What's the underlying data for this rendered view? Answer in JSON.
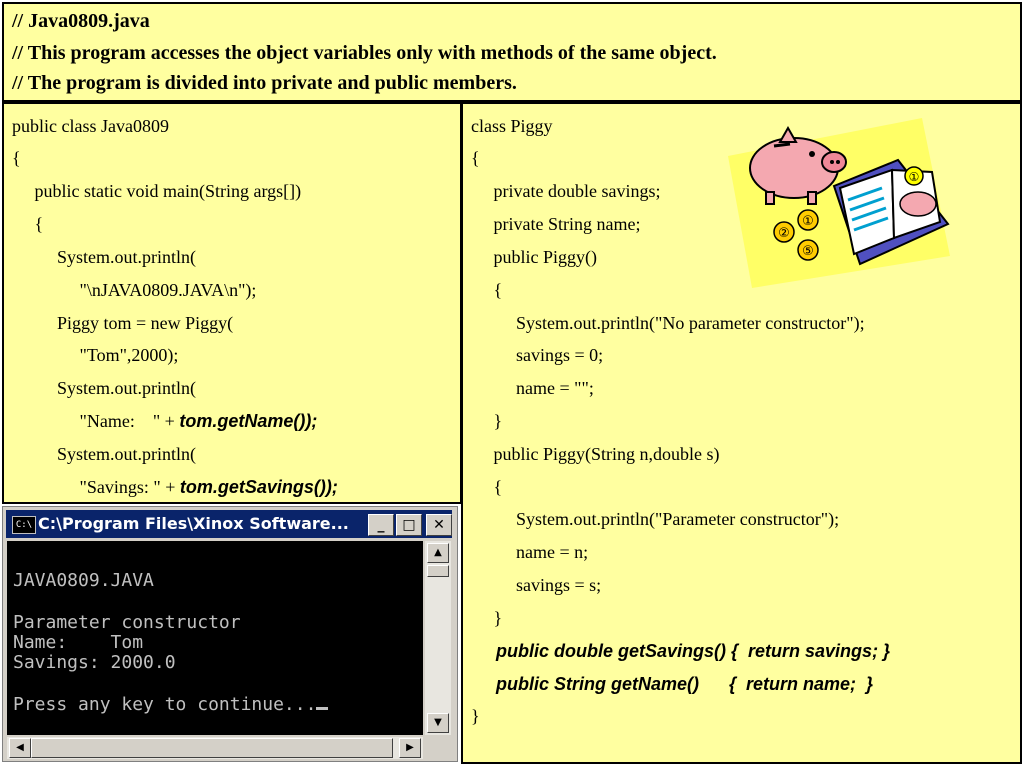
{
  "header": {
    "lines": [
      "// Java0809.java",
      "// This program accesses the object variables only with methods of the same object.",
      "// The program is divided into private and public members."
    ]
  },
  "left_code": [
    {
      "text": "public class Java0809",
      "italic_part": ""
    },
    {
      "text": "{",
      "italic_part": ""
    },
    {
      "text": "     public static void main(String args[])",
      "italic_part": ""
    },
    {
      "text": "     {",
      "italic_part": ""
    },
    {
      "text": "          System.out.println(",
      "italic_part": ""
    },
    {
      "text": "               \"\\nJAVA0809.JAVA\\n\");",
      "italic_part": ""
    },
    {
      "text": "          Piggy tom = new Piggy(",
      "italic_part": ""
    },
    {
      "text": "               \"Tom\",2000);",
      "italic_part": ""
    },
    {
      "text": "          System.out.println(",
      "italic_part": ""
    },
    {
      "text": "               \"Name:    \" + ",
      "italic_part": "tom.getName());"
    },
    {
      "text": "          System.out.println(",
      "italic_part": ""
    },
    {
      "text": "               \"Savings: \" + ",
      "italic_part": "tom.getSavings());"
    }
  ],
  "right_code": [
    {
      "text": "class Piggy",
      "italic": false
    },
    {
      "text": "{",
      "italic": false
    },
    {
      "text": "     private double savings;",
      "italic": false
    },
    {
      "text": "     private String name;",
      "italic": false
    },
    {
      "text": "     public Piggy()",
      "italic": false
    },
    {
      "text": "     {",
      "italic": false
    },
    {
      "text": "          System.out.println(\"No parameter constructor\");",
      "italic": false
    },
    {
      "text": "          savings = 0;",
      "italic": false
    },
    {
      "text": "          name = \"\";",
      "italic": false
    },
    {
      "text": "     }",
      "italic": false
    },
    {
      "text": "     public Piggy(String n,double s)",
      "italic": false
    },
    {
      "text": "     {",
      "italic": false
    },
    {
      "text": "          System.out.println(\"Parameter constructor\");",
      "italic": false
    },
    {
      "text": "          name = n;",
      "italic": false
    },
    {
      "text": "          savings = s;",
      "italic": false
    },
    {
      "text": "     }",
      "italic": false
    },
    {
      "text": "     public double getSavings() {  return savings; }",
      "italic": true
    },
    {
      "text": "     public String getName()      {  return name;  }",
      "italic": true
    },
    {
      "text": "}",
      "italic": false
    }
  ],
  "console": {
    "title": "C:\\Program Files\\Xinox Software...",
    "icon_label": "C:\\",
    "minimize": "_",
    "maximize": "□",
    "close": "✕",
    "lines": [
      "JAVA0809.JAVA",
      "",
      "Parameter constructor",
      "Name:    Tom",
      "Savings: 2000.0",
      "",
      "Press any key to continue..."
    ],
    "scroll_up": "▲",
    "scroll_down": "▼",
    "scroll_left": "◀",
    "scroll_right": "▶"
  },
  "clipart": {
    "icon": "piggy-bank-book-clipart",
    "numbers": [
      "①",
      "①",
      "②",
      "⑤"
    ]
  }
}
